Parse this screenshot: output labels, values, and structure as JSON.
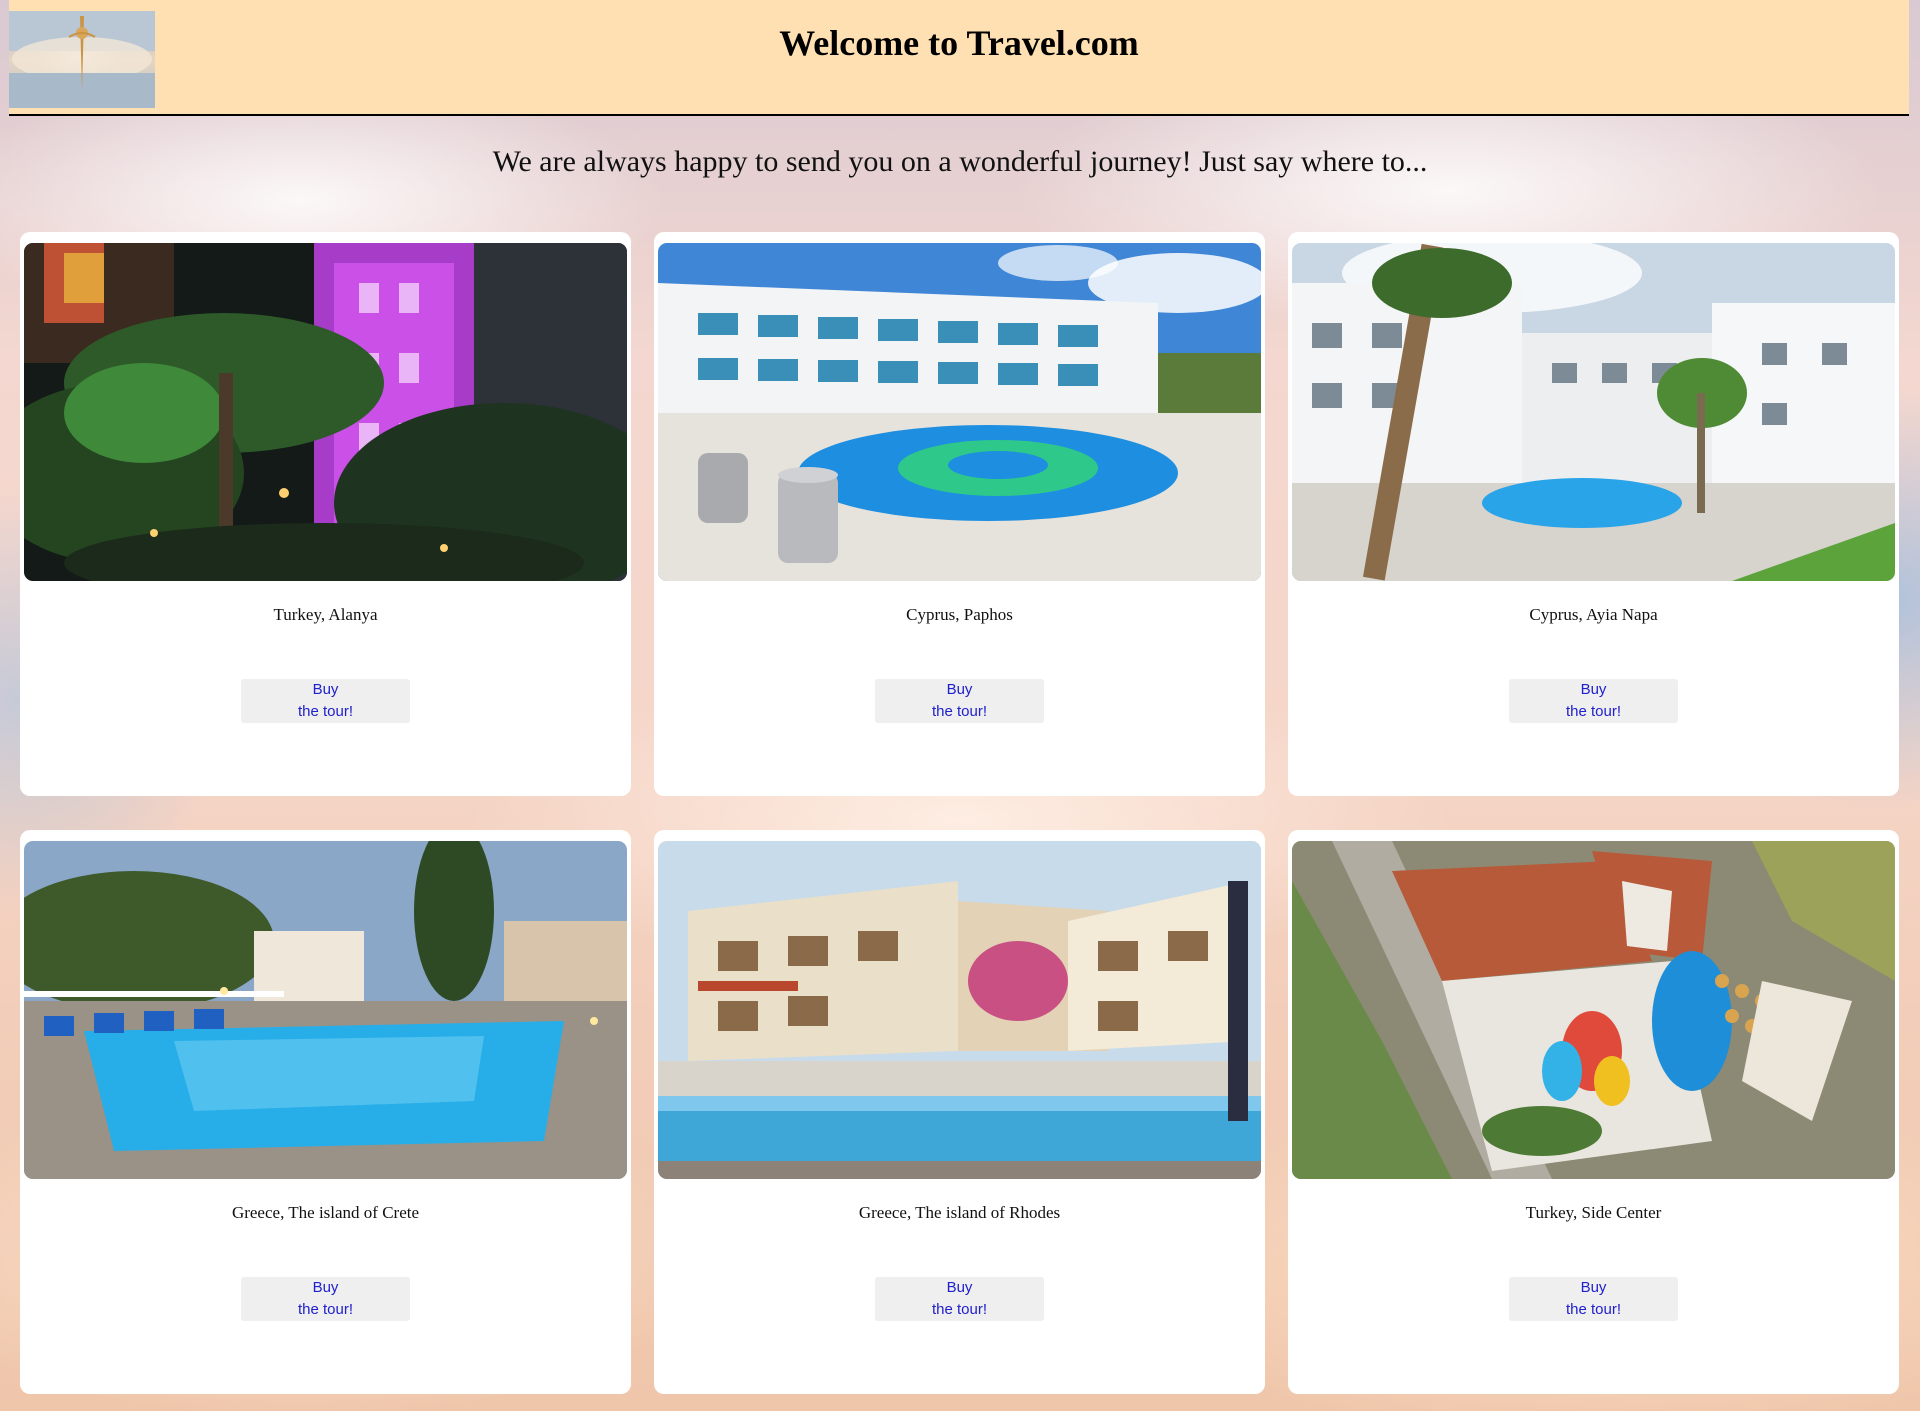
{
  "header": {
    "title": "Welcome to Travel.com"
  },
  "tagline": "We are always happy to send you on a wonderful journey! Just say where to...",
  "tours": [
    {
      "destination": "Turkey, Alanya",
      "button_line1": "Buy",
      "button_line2": "the tour!",
      "image": "hotel-night-palms-photo"
    },
    {
      "destination": "Cyprus, Paphos",
      "button_line1": "Buy",
      "button_line2": "the tour!",
      "image": "hotel-pool-photo"
    },
    {
      "destination": "Cyprus, Ayia Napa",
      "button_line1": "Buy",
      "button_line2": "the tour!",
      "image": "white-hotel-courtyard-photo"
    },
    {
      "destination": "Greece, The island of Crete",
      "button_line1": "Buy",
      "button_line2": "the tour!",
      "image": "evening-pool-photo"
    },
    {
      "destination": "Greece, The island of Rhodes",
      "button_line1": "Buy",
      "button_line2": "the tour!",
      "image": "hotel-pool-terrace-photo"
    },
    {
      "destination": "Turkey, Side Center",
      "button_line1": "Buy",
      "button_line2": "the tour!",
      "image": "aerial-resort-photo"
    }
  ],
  "colors": {
    "header_bg": "#ffe0b2",
    "button_bg": "#efefef",
    "button_text": "#2020cc"
  }
}
